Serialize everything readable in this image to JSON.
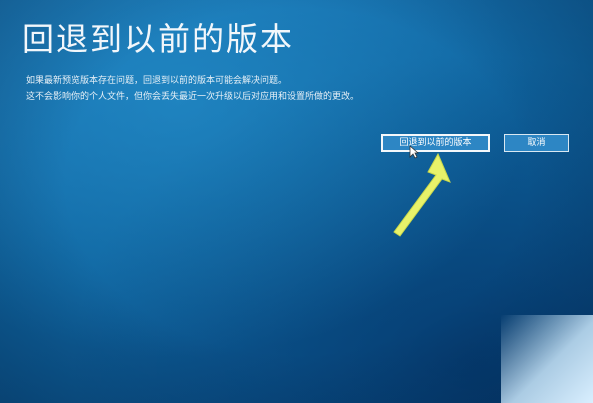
{
  "page": {
    "title": "回退到以前的版本",
    "description_line1": "如果最新预览版本存在问题，回退到以前的版本可能会解决问题。",
    "description_line2": "这不会影响你的个人文件，但你会丢失最近一次升级以后对应用和设置所做的更改。"
  },
  "buttons": {
    "rollback_label": "回退到以前的版本",
    "cancel_label": "取消"
  },
  "colors": {
    "background": "#0f649f",
    "arrow": "#e8f26a",
    "text": "#ffffff"
  },
  "icons": {
    "pointer": "mouse-cursor-icon",
    "annotation": "arrow-annotation-icon"
  }
}
